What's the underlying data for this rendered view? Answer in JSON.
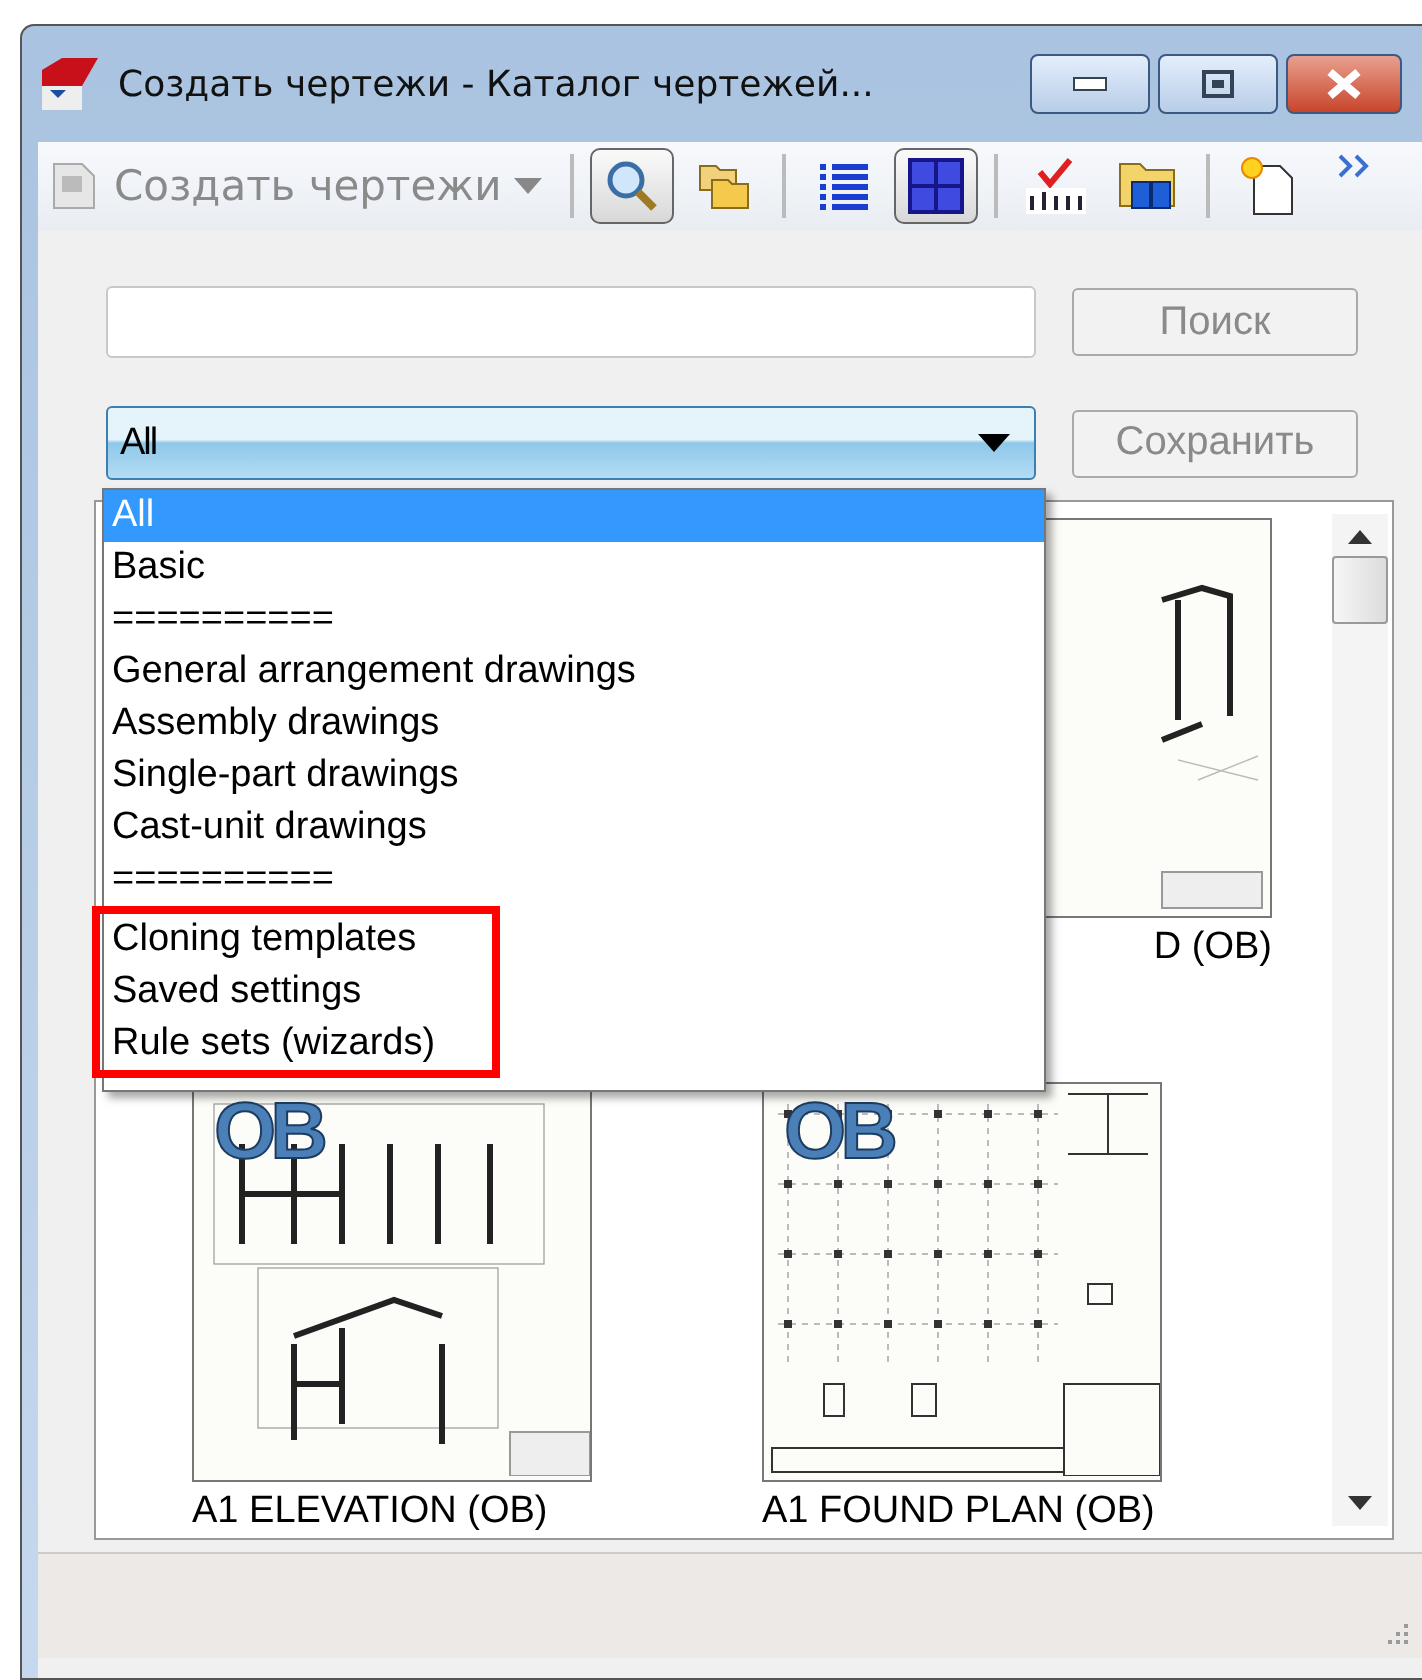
{
  "window": {
    "title": "Создать чертежи - Каталог чертежей..."
  },
  "toolbar": {
    "dropdown": {
      "label": "Создать чертежи",
      "disabled": true
    },
    "buttons": [
      {
        "kind": "search",
        "pressed": true
      },
      {
        "kind": "folders",
        "pressed": false
      },
      {
        "kind": "list",
        "pressed": false
      },
      {
        "kind": "grid",
        "pressed": true
      },
      {
        "kind": "spell",
        "pressed": false
      },
      {
        "kind": "cubes",
        "pressed": false
      },
      {
        "kind": "newdoc",
        "pressed": false
      }
    ]
  },
  "search": {
    "button": "Поиск"
  },
  "filter": {
    "value": "All",
    "save_button": "Сохранить",
    "options": [
      {
        "label": "All",
        "selected": true,
        "highlighted": false
      },
      {
        "label": "Basic",
        "selected": false,
        "highlighted": false
      },
      {
        "label": "==========",
        "selected": false,
        "highlighted": false
      },
      {
        "label": "General arrangement drawings",
        "selected": false,
        "highlighted": false
      },
      {
        "label": "Assembly drawings",
        "selected": false,
        "highlighted": false
      },
      {
        "label": "Single-part drawings",
        "selected": false,
        "highlighted": false
      },
      {
        "label": "Cast-unit drawings",
        "selected": false,
        "highlighted": false
      },
      {
        "label": "==========",
        "selected": false,
        "highlighted": false
      },
      {
        "label": "Cloning templates",
        "selected": false,
        "highlighted": true
      },
      {
        "label": "Saved settings",
        "selected": false,
        "highlighted": true
      },
      {
        "label": "Rule sets (wizards)",
        "selected": false,
        "highlighted": true
      }
    ]
  },
  "thumbnails": [
    {
      "kind": "iso",
      "label": "D (OB)"
    },
    {
      "kind": "elevation",
      "badge": "OB",
      "label": "A1 ELEVATION (OB)"
    },
    {
      "kind": "plan",
      "badge": "OB",
      "label": "A1 FOUND PLAN (OB)"
    }
  ]
}
